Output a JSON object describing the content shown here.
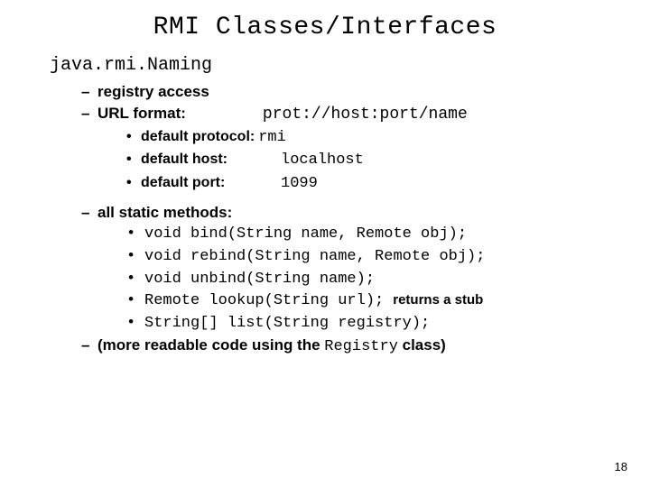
{
  "title": "RMI Classes/Interfaces",
  "classname": "java.rmi.Naming",
  "b1": "registry access",
  "b2_label": "URL format:",
  "b2_value": "prot://host:port/name",
  "proto_label": "default protocol:",
  "proto_value": "rmi",
  "host_label": "default host:",
  "host_value": "localhost",
  "port_label": "default port:",
  "port_value": "1099",
  "b3": "all static methods:",
  "methods": {
    "m0": "void bind(String name, Remote obj);",
    "m1": "void rebind(String name, Remote obj);",
    "m2": "void unbind(String name);",
    "m3": "Remote lookup(String url);",
    "m3_note": "returns a stub",
    "m4": "String[] list(String registry);"
  },
  "b4_pre": "(more readable code using the ",
  "b4_code": "Registry",
  "b4_post": " class)",
  "pagenum": "18"
}
